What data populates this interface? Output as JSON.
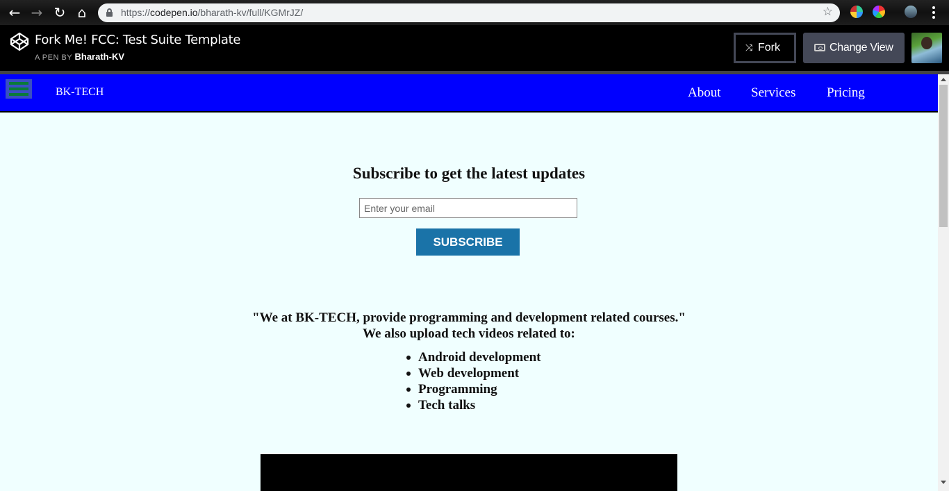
{
  "browser": {
    "url_prefix": "https://",
    "url_host": "codepen.io",
    "url_path": "/bharath-kv/full/KGMrJZ/"
  },
  "codepen": {
    "title": "Fork Me! FCC: Test Suite Template",
    "by_label": "A PEN BY",
    "author": "Bharath-KV",
    "fork_label": "Fork",
    "change_view_label": "Change View"
  },
  "site": {
    "brand_alt": "BK-TECH",
    "nav": [
      "About",
      "Services",
      "Pricing"
    ],
    "subscribe_heading": "Subscribe to get the latest updates",
    "email_placeholder": "Enter your email",
    "subscribe_button": "SUBSCRIBE",
    "about_line1": "\"We at BK-TECH, provide programming and development related courses.\"",
    "about_line2": "We also upload tech videos related to:",
    "topics": [
      "Android development",
      "Web development",
      "Programming",
      "Tech talks"
    ]
  },
  "colors": {
    "nav_bg": "#0000ff",
    "page_bg": "#f0ffff",
    "button_bg": "#1a73a8"
  }
}
